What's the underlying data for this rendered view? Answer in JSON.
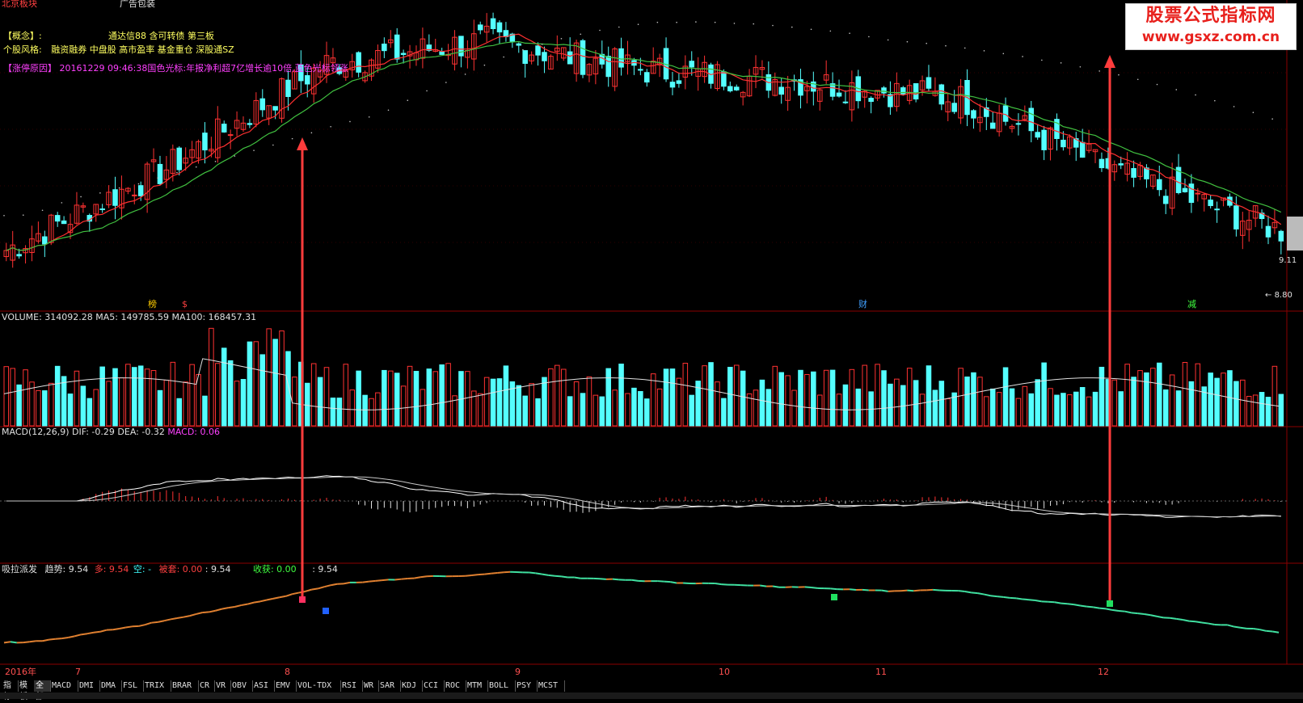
{
  "header": {
    "region_text": "北京板块",
    "category_text": "广告包装",
    "concept_label": "【概念】:",
    "concept_value": "通达信88 含可转债 第三板",
    "style_label": "个股风格:",
    "style_value": "融资融券 中盘股 高市盈率 基金重仓 深股通SZ",
    "limitup_label": "【涨停原因】",
    "limitup_value": "20161229  09:46:38国色光标:年报净利超7亿增长逾10倍,蓝色光标领涨"
  },
  "watermark": {
    "title": "股票公式指标网",
    "url": "www.gsxz.com.cn"
  },
  "price_labels": {
    "current": "9.11",
    "low": "8.80"
  },
  "event_markers": [
    "榜",
    "$",
    "财",
    "减"
  ],
  "volume_panel": {
    "label": "VOLUME: 314092.28",
    "ma5": "MA5: 149785.59",
    "ma100": "MA100: 168457.31"
  },
  "macd_panel": {
    "label": "MACD(12,26,9)",
    "dif": "DIF: -0.29",
    "dea": "DEA: -0.32",
    "macd": "MACD: 0.06"
  },
  "indicator_panel": {
    "name": "吸拉派发",
    "trend": "趋势: 9.54",
    "long": "多: 9.54",
    "short": "空: -",
    "trap": "被套: 0.00",
    "trap_val": ": 9.54",
    "harvest": "收获: 0.00",
    "harvest_val": ": 9.54"
  },
  "time_axis": [
    "2016年",
    "7",
    "8",
    "9",
    "10",
    "11",
    "12"
  ],
  "tabs": [
    "指标",
    "模板",
    "全部",
    "MACD",
    "DMI",
    "DMA",
    "FSL",
    "TRIX",
    "BRAR",
    "CR",
    "VR",
    "OBV",
    "ASI",
    "EMV",
    "VOL-TDX",
    "RSI",
    "WR",
    "SAR",
    "KDJ",
    "CCI",
    "ROC",
    "MTM",
    "BOLL",
    "PSY",
    "MCST"
  ],
  "colors": {
    "up": "#ff3232",
    "down": "#54ffff",
    "ma_red": "#ff3030",
    "ma_green": "#40c040",
    "arrow": "#ff3c3c",
    "grid": "#8b0000"
  },
  "chart_data": {
    "type": "candlestick",
    "x": [
      "2016-07",
      "2016-08",
      "2016-09",
      "2016-10",
      "2016-11",
      "2016-12"
    ],
    "price_close_approx": [
      9.2,
      10.6,
      12.4,
      12.8,
      12.3,
      12.1,
      11.8,
      10.5,
      9.54
    ],
    "current_price": 9.11,
    "marked_low": 8.8,
    "volume": {
      "last": 314092.28,
      "ma5": 149785.59,
      "ma100": 168457.31
    },
    "macd": {
      "dif": -0.29,
      "dea": -0.32,
      "macd": 0.06
    },
    "indicator_吸拉派发": {
      "trend": 9.54,
      "long": 9.54,
      "trap": 0.0,
      "harvest": 0.0
    },
    "arrows": [
      "2016-08",
      "2016-12"
    ]
  }
}
